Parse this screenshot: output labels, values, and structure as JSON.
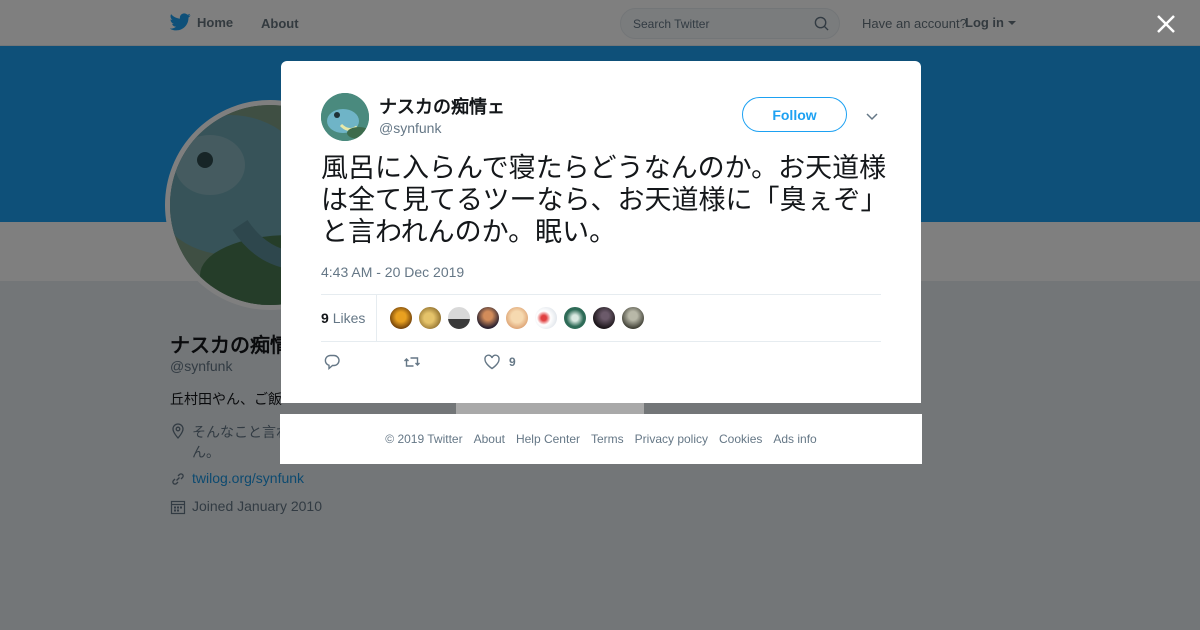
{
  "topbar": {
    "home_label": "Home",
    "about_label": "About",
    "search_placeholder": "Search Twitter",
    "account_prompt": "Have an account?",
    "login_label": "Log in"
  },
  "profile": {
    "name": "ナスカの痴情ェ",
    "handle": "@synfunk",
    "bio": "丘村田やん、ご飯",
    "location": "そんなこと言わ ん。",
    "link": "twilog.org/synfunk",
    "joined": "Joined January 2010"
  },
  "tweet": {
    "author_name": "ナスカの痴情ェ",
    "author_handle": "@synfunk",
    "follow_label": "Follow",
    "text": "風呂に入らんで寝たらどうなんのか。お天道様は全て見てるツーなら、お天道様に「臭ぇぞ」と言われんのか。眠い。",
    "timestamp": "4:43 AM - 20 Dec 2019",
    "likes_count": "9",
    "likes_label": "Likes",
    "like_action_count": "9"
  },
  "footer": {
    "copyright": "© 2019 Twitter",
    "links": [
      "About",
      "Help Center",
      "Terms",
      "Privacy policy",
      "Cookies",
      "Ads info"
    ]
  },
  "icons": {
    "twitter_bird": "twitter-bird-icon",
    "search": "search-icon",
    "close": "close-icon",
    "chevron": "chevron-down-icon",
    "reply": "reply-icon",
    "retweet": "retweet-icon",
    "like": "heart-icon",
    "location": "location-pin-icon",
    "link": "link-icon",
    "calendar": "calendar-icon"
  },
  "colors": {
    "brand_blue": "#1da1f2",
    "text_primary": "#14171a",
    "text_secondary": "#657786",
    "link_blue": "#1b95e0"
  }
}
